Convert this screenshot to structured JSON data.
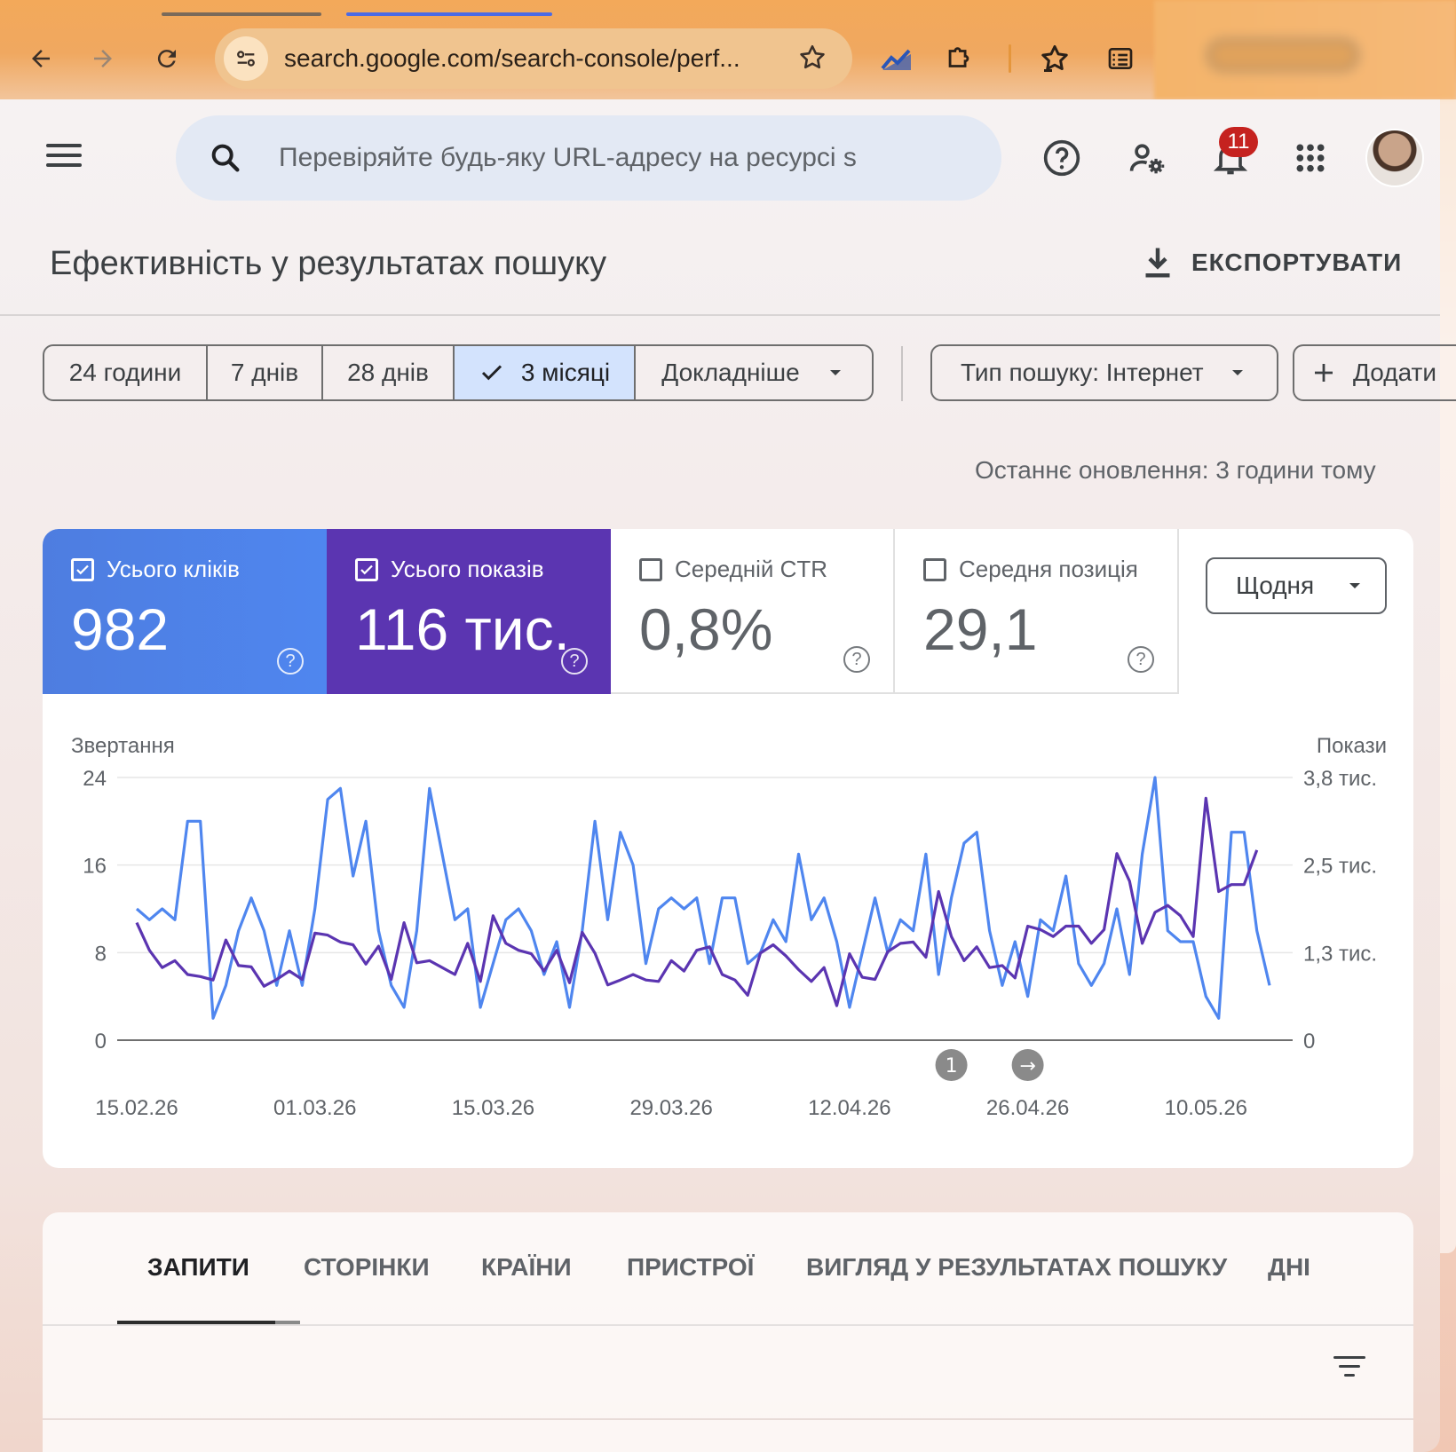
{
  "browser": {
    "url": "search.google.com/search-console/perf...",
    "back_icon": "arrow-left-icon",
    "forward_icon": "arrow-right-icon",
    "reload_icon": "reload-icon",
    "site_info_icon": "tune-icon",
    "bookmark_icon": "star-outline-icon",
    "extensions": [
      "chart-extension-icon",
      "puzzle-icon",
      "bookmarks-star-icon",
      "reading-list-icon"
    ]
  },
  "header": {
    "menu_icon": "hamburger-icon",
    "search_placeholder": "Перевіряйте будь-яку URL-адресу на ресурсі s",
    "help_icon": "help-icon",
    "users_settings_icon": "manage-accounts-icon",
    "notifications_count": "11",
    "apps_icon": "apps-grid-icon"
  },
  "page": {
    "title": "Ефективність у результатах пошуку",
    "export_label": "ЕКСПОРТУВАТИ",
    "date_ranges": [
      {
        "label": "24 години",
        "selected": false
      },
      {
        "label": "7 днів",
        "selected": false
      },
      {
        "label": "28 днів",
        "selected": false
      },
      {
        "label": "3 місяці",
        "selected": true
      },
      {
        "label": "Докладніше",
        "selected": false
      }
    ],
    "search_type": "Тип пошуку: Інтернет",
    "add_filter": "Додати",
    "last_updated": "Останнє оновлення: 3 години тому"
  },
  "metrics": [
    {
      "label": "Усього кліків",
      "value": "982",
      "checked": true,
      "color": "#4e7de0"
    },
    {
      "label": "Усього показів",
      "value": "116 тис.",
      "checked": true,
      "color": "#5b35b1"
    },
    {
      "label": "Середній CTR",
      "value": "0,8%",
      "checked": false
    },
    {
      "label": "Середня позиція",
      "value": "29,1",
      "checked": false
    }
  ],
  "granularity": "Щодня",
  "chart_data": {
    "type": "line",
    "left_axis_label": "Звертання",
    "right_axis_label": "Покази",
    "left_ticks": [
      "0",
      "8",
      "16",
      "24"
    ],
    "right_ticks": [
      "0",
      "1,3 тис.",
      "2,5 тис.",
      "3,8 тис."
    ],
    "ylim_left": [
      0,
      24
    ],
    "ylim_right": [
      0,
      3800
    ],
    "x_tick_labels": [
      "15.02.26",
      "01.03.26",
      "15.03.26",
      "29.03.26",
      "12.04.26",
      "26.04.26",
      "10.05.26"
    ],
    "grid": true,
    "annotations": [
      {
        "label": "1",
        "date_index": 64
      },
      {
        "label": "→",
        "date_index": 70
      }
    ],
    "series": [
      {
        "name": "Усього кліків",
        "axis": "left",
        "color": "#4f86ef",
        "values": [
          12,
          11,
          12,
          11,
          20,
          20,
          2,
          5,
          10,
          13,
          10,
          5,
          10,
          5,
          12,
          22,
          23,
          15,
          20,
          10,
          5,
          3,
          10,
          23,
          17,
          11,
          12,
          3,
          7,
          11,
          12,
          10,
          6,
          9,
          3,
          10,
          20,
          11,
          19,
          16,
          7,
          12,
          13,
          12,
          13,
          7,
          13,
          13,
          7,
          8,
          11,
          9,
          17,
          11,
          13,
          9,
          3,
          8,
          13,
          8,
          11,
          10,
          17,
          6,
          13,
          18,
          19,
          10,
          5,
          9,
          4,
          11,
          10,
          15,
          7,
          5,
          7,
          12,
          6,
          17,
          24,
          10,
          9,
          9,
          4,
          2,
          19,
          19,
          10,
          5
        ]
      },
      {
        "name": "Усього показів",
        "axis": "right",
        "color": "#5b35b1",
        "values": [
          1700,
          1300,
          1050,
          1150,
          950,
          920,
          870,
          1450,
          1080,
          1060,
          780,
          880,
          1000,
          880,
          1550,
          1520,
          1420,
          1380,
          1100,
          1360,
          880,
          1700,
          1120,
          1150,
          1050,
          950,
          1400,
          850,
          1800,
          1400,
          1300,
          1250,
          1000,
          1300,
          830,
          1560,
          1260,
          800,
          870,
          950,
          870,
          850,
          1150,
          1000,
          1300,
          1350,
          950,
          870,
          650,
          1260,
          1380,
          1220,
          1020,
          850,
          1050,
          500,
          1250,
          910,
          880,
          1280,
          1400,
          1420,
          1200,
          2150,
          1500,
          1150,
          1350,
          1050,
          1080,
          900,
          1650,
          1600,
          1500,
          1650,
          1650,
          1400,
          1600,
          2700,
          2300,
          1400,
          1850,
          1950,
          1800,
          1500,
          3500,
          2150,
          2250,
          2250,
          2750
        ]
      }
    ]
  },
  "tabs": {
    "items": [
      "ЗАПИТИ",
      "СТОРІНКИ",
      "КРАЇНИ",
      "ПРИСТРОЇ",
      "ВИГЛЯД У РЕЗУЛЬТАТАХ ПОШУКУ",
      "ДНІ"
    ],
    "active": 0,
    "filter_icon": "filter-list-icon"
  }
}
